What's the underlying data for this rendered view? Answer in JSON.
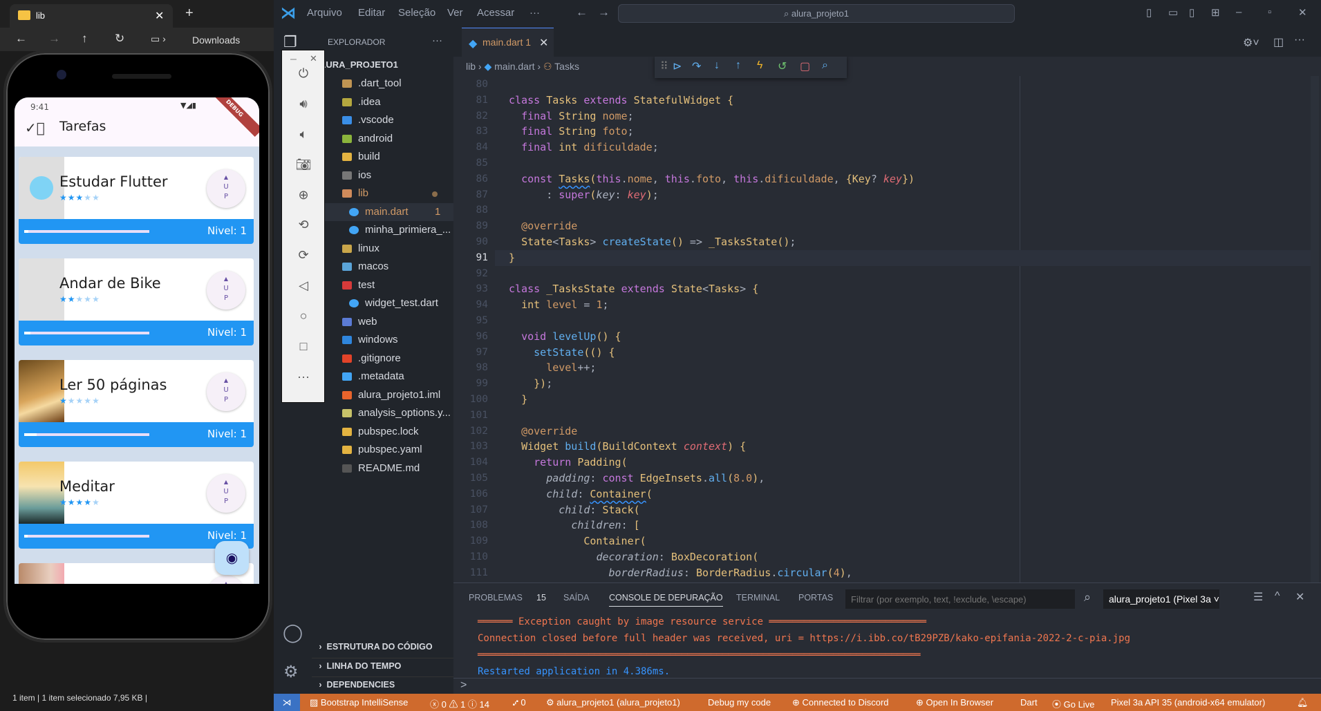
{
  "file_explorer": {
    "tab_title": "lib",
    "new_tab": "+",
    "breadcrumb": "Downloads",
    "status": "1 item  |  1 item selecionado  7,95 KB  |"
  },
  "phone": {
    "time": "9:41",
    "debug_banner": "DEBUG",
    "app_title": "Tarefas",
    "tasks": [
      {
        "title": "Estudar Flutter",
        "stars": 3,
        "level_label": "Nivel: 1",
        "progress": 0.033,
        "image": "bird"
      },
      {
        "title": "Andar de Bike",
        "stars": 2,
        "level_label": "Nivel: 1",
        "progress": 0.05,
        "image": "empty"
      },
      {
        "title": "Ler 50 páginas",
        "stars": 1,
        "level_label": "Nivel: 1",
        "progress": 0.1,
        "image": "book"
      },
      {
        "title": "Meditar",
        "stars": 4,
        "level_label": "Nivel: 1",
        "progress": 0.025,
        "image": "meditate"
      },
      {
        "title": "",
        "stars": 0,
        "level_label": "",
        "progress": 0,
        "image": "person"
      }
    ],
    "up_top": "U",
    "up_bottom": "P",
    "fab_icon": "eye-icon"
  },
  "emulator_toolbar": {
    "icons": [
      "power-icon",
      "volume-up-icon",
      "volume-down-icon",
      "camera-icon",
      "zoom-icon",
      "rotate-left-icon",
      "rotate-right-icon",
      "back-icon",
      "home-icon",
      "overview-icon",
      "more-icon"
    ]
  },
  "titlebar": {
    "menu": [
      "Arquivo",
      "Editar",
      "Seleção",
      "Ver",
      "Acessar",
      "···"
    ],
    "search": "alura_projeto1"
  },
  "explorer": {
    "header": "EXPLORADOR",
    "more": "···",
    "root": "ALURA_PROJETO1",
    "items": [
      {
        "label": ".dart_tool",
        "type": "folder",
        "open": false,
        "depth": 0,
        "color": "#c09553"
      },
      {
        "label": ".idea",
        "type": "folder",
        "open": false,
        "depth": 0,
        "color": "#b5a83f"
      },
      {
        "label": ".vscode",
        "type": "folder",
        "open": false,
        "depth": 0,
        "color": "#3a8ee6"
      },
      {
        "label": "android",
        "type": "folder",
        "open": false,
        "depth": 0,
        "color": "#8bb43c"
      },
      {
        "label": "build",
        "type": "folder",
        "open": false,
        "depth": 0,
        "color": "#e3b341"
      },
      {
        "label": "ios",
        "type": "folder",
        "open": false,
        "depth": 0,
        "color": "#777"
      },
      {
        "label": "lib",
        "type": "folder",
        "open": true,
        "depth": 0,
        "color": "#d08b5b",
        "modified": true
      },
      {
        "label": "main.dart",
        "type": "dart",
        "depth": 1,
        "selected": true,
        "badge": "1",
        "color": "#42a5f5"
      },
      {
        "label": "minha_primiera_...",
        "type": "dart",
        "depth": 1,
        "color": "#42a5f5"
      },
      {
        "label": "linux",
        "type": "folder",
        "open": false,
        "depth": 0,
        "color": "#c9a64a"
      },
      {
        "label": "macos",
        "type": "folder",
        "open": false,
        "depth": 0,
        "color": "#5aa4d8"
      },
      {
        "label": "test",
        "type": "folder",
        "open": true,
        "depth": 0,
        "color": "#d73a3a"
      },
      {
        "label": "widget_test.dart",
        "type": "dart",
        "depth": 1,
        "color": "#42a5f5"
      },
      {
        "label": "web",
        "type": "folder",
        "open": false,
        "depth": 0,
        "color": "#5b7bd5"
      },
      {
        "label": "windows",
        "type": "folder",
        "open": false,
        "depth": 0,
        "color": "#2f86dd"
      },
      {
        "label": ".gitignore",
        "type": "file",
        "depth": 0,
        "color": "#e24329"
      },
      {
        "label": ".metadata",
        "type": "file",
        "depth": 0,
        "color": "#42a5f5"
      },
      {
        "label": "alura_projeto1.iml",
        "type": "file",
        "depth": 0,
        "color": "#e8642c"
      },
      {
        "label": "analysis_options.y...",
        "type": "file",
        "depth": 0,
        "color": "#c7c269"
      },
      {
        "label": "pubspec.lock",
        "type": "file",
        "depth": 0,
        "color": "#e3b341"
      },
      {
        "label": "pubspec.yaml",
        "type": "file",
        "depth": 0,
        "color": "#e3b341"
      },
      {
        "label": "README.md",
        "type": "file",
        "depth": 0,
        "color": "#555"
      }
    ],
    "sections": [
      "ESTRUTURA DO CÓDIGO",
      "LINHA DO TEMPO",
      "DEPENDENCIES"
    ]
  },
  "editor": {
    "tab": "main.dart 1",
    "breadcrumb": [
      "lib",
      "main.dart",
      "Tasks"
    ],
    "current_line": 91,
    "first_line": 80,
    "lines": [
      "",
      "class Tasks extends StatefulWidget {",
      "  final String nome;",
      "  final String foto;",
      "  final int dificuldade;",
      "",
      "  const Tasks(this.nome, this.foto, this.dificuldade, {Key? key})",
      "      : super(key: key);",
      "",
      "  @override",
      "  State<Tasks> createState() => _TasksState();",
      "}",
      "",
      "class _TasksState extends State<Tasks> {",
      "  int level = 1;",
      "",
      "  void levelUp() {",
      "    setState(() {",
      "      level++;",
      "    });",
      "  }",
      "",
      "  @override",
      "  Widget build(BuildContext context) {",
      "    return Padding(",
      "      padding: const EdgeInsets.all(8.0),",
      "      child: Container(",
      "        child: Stack(",
      "          children: [",
      "            Container(",
      "              decoration: BoxDecoration(",
      "                borderRadius: BorderRadius.circular(4),"
    ],
    "squiggles": [
      {
        "line": 86,
        "word": "Tasks"
      },
      {
        "line": 106,
        "word": "Container"
      }
    ]
  },
  "panel": {
    "tabs": [
      "PROBLEMAS",
      "SAÍDA",
      "CONSOLE DE DEPURAÇÃO",
      "TERMINAL",
      "PORTAS"
    ],
    "problems_count": "15",
    "active_tab": "CONSOLE DE DEPURAÇÃO",
    "filter_placeholder": "Filtrar (por exemplo, text, !exclude, \\escape)",
    "session": "alura_projeto1 (Pixel 3a",
    "console": [
      {
        "text": "══════ Exception caught by image resource service ═══════════════════════════",
        "color": "#f0764f"
      },
      {
        "text": "Connection closed before full header was received, uri = https://i.ibb.co/tB29PZB/kako-epifania-2022-2-c-pia.jpg",
        "color": "#f0764f"
      },
      {
        "text": "════════════════════════════════════════════════════════════════════════════",
        "color": "#f0764f"
      },
      {
        "text": "Restarted application in 4.386ms.",
        "color": "#3794ff"
      }
    ],
    "prompt": ">"
  },
  "statusbar": {
    "color": "#cf6a2d",
    "items": [
      "Bootstrap IntelliSense",
      "ⓧ 0  ⚠ 1  ⓘ 14",
      "⑇ 0",
      "alura_projeto1 (alura_projeto1)",
      "Debug my code",
      "Connected to Discord",
      "Open In Browser",
      "Dart",
      "Go Live",
      "Pixel 3a API 35 (android-x64 emulator)"
    ]
  }
}
